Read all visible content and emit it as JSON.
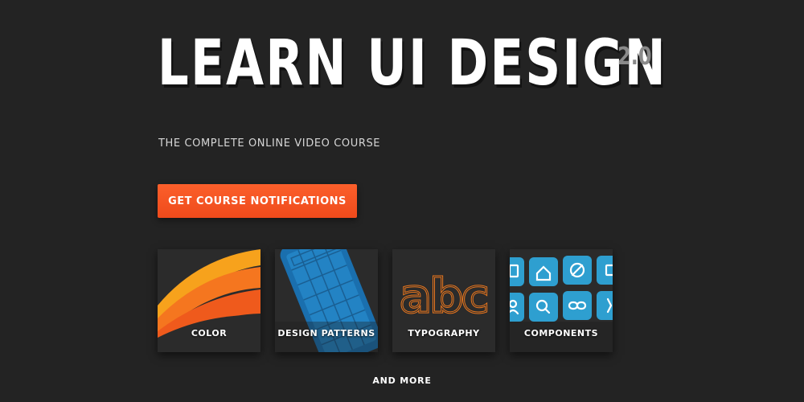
{
  "header": {
    "title": "LEARN UI DESIGN",
    "version": "2.0",
    "subtitle": "THE COMPLETE ONLINE VIDEO COURSE"
  },
  "cta": {
    "label": "GET COURSE NOTIFICATIONS",
    "color": "#f4532a"
  },
  "topics": [
    {
      "label": "COLOR",
      "icon": "color-swoosh-art"
    },
    {
      "label": "DESIGN PATTERNS",
      "icon": "phone-wireframe-art"
    },
    {
      "label": "TYPOGRAPHY",
      "icon": "abc-outline-art",
      "art_text": "abc"
    },
    {
      "label": "COMPONENTS",
      "icon": "icon-buttons-grid-art"
    }
  ],
  "footer": {
    "more_label": "AND MORE"
  },
  "colors": {
    "background": "#232323",
    "accent": "#f4532a",
    "card_blue": "#2e9fd0",
    "typography_orange": "#e8761e"
  }
}
